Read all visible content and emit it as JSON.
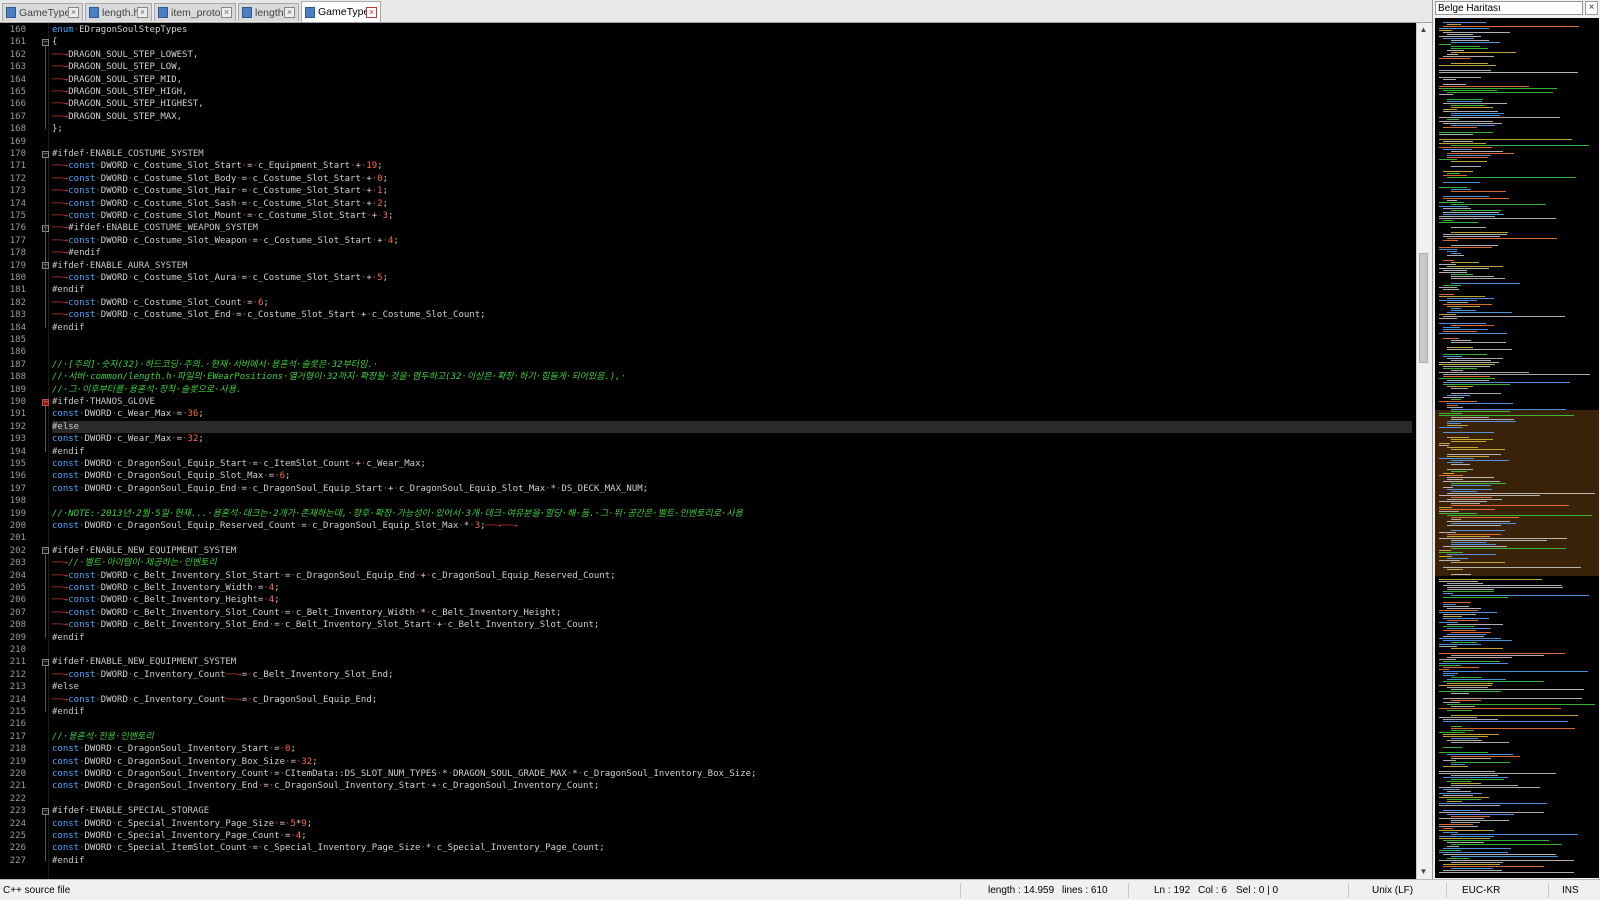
{
  "tabs": [
    {
      "label": "GameType.h",
      "active": false
    },
    {
      "label": "length.h",
      "active": false
    },
    {
      "label": "item_proto.txt",
      "active": false
    },
    {
      "label": "length.h",
      "active": false
    },
    {
      "label": "GameType.h",
      "active": true
    }
  ],
  "document_map": {
    "title": "Belge Haritası",
    "close_label": "×"
  },
  "editor": {
    "current_line": 192,
    "lines": [
      {
        "n": "160",
        "t": "enum·EDragonSoulStepTypes"
      },
      {
        "n": "161",
        "t": "{"
      },
      {
        "n": "162",
        "t": "\t→DRAGON_SOUL_STEP_LOWEST,"
      },
      {
        "n": "163",
        "t": "\t→DRAGON_SOUL_STEP_LOW,"
      },
      {
        "n": "164",
        "t": "\t→DRAGON_SOUL_STEP_MID,"
      },
      {
        "n": "165",
        "t": "\t→DRAGON_SOUL_STEP_HIGH,"
      },
      {
        "n": "166",
        "t": "\t→DRAGON_SOUL_STEP_HIGHEST,"
      },
      {
        "n": "167",
        "t": "\t→DRAGON_SOUL_STEP_MAX,"
      },
      {
        "n": "168",
        "t": "};"
      },
      {
        "n": "169",
        "t": ""
      },
      {
        "n": "170",
        "t": "#ifdef·ENABLE_COSTUME_SYSTEM"
      },
      {
        "n": "171",
        "t": "\t→const·DWORD·c_Costume_Slot_Start·=·c_Equipment_Start·+·19;"
      },
      {
        "n": "172",
        "t": "\t→const·DWORD·c_Costume_Slot_Body·=·c_Costume_Slot_Start·+·0;"
      },
      {
        "n": "173",
        "t": "\t→const·DWORD·c_Costume_Slot_Hair·=·c_Costume_Slot_Start·+·1;"
      },
      {
        "n": "174",
        "t": "\t→const·DWORD·c_Costume_Slot_Sash·=·c_Costume_Slot_Start·+·2;"
      },
      {
        "n": "175",
        "t": "\t→const·DWORD·c_Costume_Slot_Mount·=·c_Costume_Slot_Start·+·3;"
      },
      {
        "n": "176",
        "t": "\t→#ifdef·ENABLE_COSTUME_WEAPON_SYSTEM"
      },
      {
        "n": "177",
        "t": "\t→const·DWORD·c_Costume_Slot_Weapon·=·c_Costume_Slot_Start·+·4;"
      },
      {
        "n": "178",
        "t": "\t→#endif"
      },
      {
        "n": "179",
        "t": "#ifdef·ENABLE_AURA_SYSTEM"
      },
      {
        "n": "180",
        "t": "\t→const·DWORD·c_Costume_Slot_Aura·=·c_Costume_Slot_Start·+·5;"
      },
      {
        "n": "181",
        "t": "#endif"
      },
      {
        "n": "182",
        "t": "\t→const·DWORD·c_Costume_Slot_Count·=·6;"
      },
      {
        "n": "183",
        "t": "\t→const·DWORD·c_Costume_Slot_End·=·c_Costume_Slot_Start·+·c_Costume_Slot_Count;"
      },
      {
        "n": "184",
        "t": "#endif"
      },
      {
        "n": "185",
        "t": ""
      },
      {
        "n": "186",
        "t": ""
      },
      {
        "n": "187",
        "t": "//·[주의]·숫자(32)·하드코딩·주의.·현재·서버에서·용혼석·슬롯은·32부터임.·"
      },
      {
        "n": "188",
        "t": "//·서버·common/length.h·파일의·EWearPositions·열거형이·32까지·확장될·것을·염두하고(32·이상은·확장·하기·힘들게·되어있음.),·"
      },
      {
        "n": "189",
        "t": "//·그·이후부터를·용혼석·장착·슬롯으로·사용."
      },
      {
        "n": "190",
        "t": "#ifdef·THANOS_GLOVE"
      },
      {
        "n": "191",
        "t": "const·DWORD·c_Wear_Max·=·36;"
      },
      {
        "n": "192",
        "t": "#else"
      },
      {
        "n": "193",
        "t": "const·DWORD·c_Wear_Max·=·32;"
      },
      {
        "n": "194",
        "t": "#endif"
      },
      {
        "n": "195",
        "t": "const·DWORD·c_DragonSoul_Equip_Start·=·c_ItemSlot_Count·+·c_Wear_Max;"
      },
      {
        "n": "196",
        "t": "const·DWORD·c_DragonSoul_Equip_Slot_Max·=·6;"
      },
      {
        "n": "197",
        "t": "const·DWORD·c_DragonSoul_Equip_End·=·c_DragonSoul_Equip_Start·+·c_DragonSoul_Equip_Slot_Max·*·DS_DECK_MAX_NUM;"
      },
      {
        "n": "198",
        "t": ""
      },
      {
        "n": "199",
        "t": "//·NOTE:·2013년·2월·5일·현재...·용혼석·데크는·2개가·존재하는데,·향후·확장·가능성이·있어서·3개·데크·여유분을·할당·해·둠.·그·뒤·공간은·벨트·인벤토리로·사용"
      },
      {
        "n": "200",
        "t": "const·DWORD·c_DragonSoul_Equip_Reserved_Count·=·c_DragonSoul_Equip_Slot_Max·*·3;\t→\t→"
      },
      {
        "n": "201",
        "t": ""
      },
      {
        "n": "202",
        "t": "#ifdef·ENABLE_NEW_EQUIPMENT_SYSTEM"
      },
      {
        "n": "203",
        "t": "\t→//·벨트·아이템이·제공하는·인벤토리"
      },
      {
        "n": "204",
        "t": "\t→const·DWORD·c_Belt_Inventory_Slot_Start·=·c_DragonSoul_Equip_End·+·c_DragonSoul_Equip_Reserved_Count;"
      },
      {
        "n": "205",
        "t": "\t→const·DWORD·c_Belt_Inventory_Width·=·4;"
      },
      {
        "n": "206",
        "t": "\t→const·DWORD·c_Belt_Inventory_Height=·4;"
      },
      {
        "n": "207",
        "t": "\t→const·DWORD·c_Belt_Inventory_Slot_Count·=·c_Belt_Inventory_Width·*·c_Belt_Inventory_Height;"
      },
      {
        "n": "208",
        "t": "\t→const·DWORD·c_Belt_Inventory_Slot_End·=·c_Belt_Inventory_Slot_Start·+·c_Belt_Inventory_Slot_Count;"
      },
      {
        "n": "209",
        "t": "#endif"
      },
      {
        "n": "210",
        "t": ""
      },
      {
        "n": "211",
        "t": "#ifdef·ENABLE_NEW_EQUIPMENT_SYSTEM"
      },
      {
        "n": "212",
        "t": "\t→const·DWORD·c_Inventory_Count\t→=·c_Belt_Inventory_Slot_End;"
      },
      {
        "n": "213",
        "t": "#else"
      },
      {
        "n": "214",
        "t": "\t→const·DWORD·c_Inventory_Count\t→=·c_DragonSoul_Equip_End;"
      },
      {
        "n": "215",
        "t": "#endif"
      },
      {
        "n": "216",
        "t": ""
      },
      {
        "n": "217",
        "t": "//·용혼석·전용·인벤토리"
      },
      {
        "n": "218",
        "t": "const·DWORD·c_DragonSoul_Inventory_Start·=·0;"
      },
      {
        "n": "219",
        "t": "const·DWORD·c_DragonSoul_Inventory_Box_Size·=·32;"
      },
      {
        "n": "220",
        "t": "const·DWORD·c_DragonSoul_Inventory_Count·=·CItemData::DS_SLOT_NUM_TYPES·*·DRAGON_SOUL_GRADE_MAX·*·c_DragonSoul_Inventory_Box_Size;"
      },
      {
        "n": "221",
        "t": "const·DWORD·c_DragonSoul_Inventory_End·=·c_DragonSoul_Inventory_Start·+·c_DragonSoul_Inventory_Count;"
      },
      {
        "n": "222",
        "t": ""
      },
      {
        "n": "223",
        "t": "#ifdef·ENABLE_SPECIAL_STORAGE"
      },
      {
        "n": "224",
        "t": "const·DWORD·c_Special_Inventory_Page_Size·=·5*9;"
      },
      {
        "n": "225",
        "t": "const·DWORD·c_Special_Inventory_Page_Count·=·4;"
      },
      {
        "n": "226",
        "t": "const·DWORD·c_Special_ItemSlot_Count·=·c_Special_Inventory_Page_Size·*·c_Special_Inventory_Page_Count;"
      },
      {
        "n": "227",
        "t": "#endif"
      }
    ]
  },
  "status": {
    "file_type": "C++ source file",
    "length": "length : 14.959",
    "lines": "lines : 610",
    "ln": "Ln : 192",
    "col": "Col : 6",
    "sel": "Sel : 0 | 0",
    "eol": "Unix (LF)",
    "encoding": "EUC-KR",
    "mode": "INS"
  }
}
